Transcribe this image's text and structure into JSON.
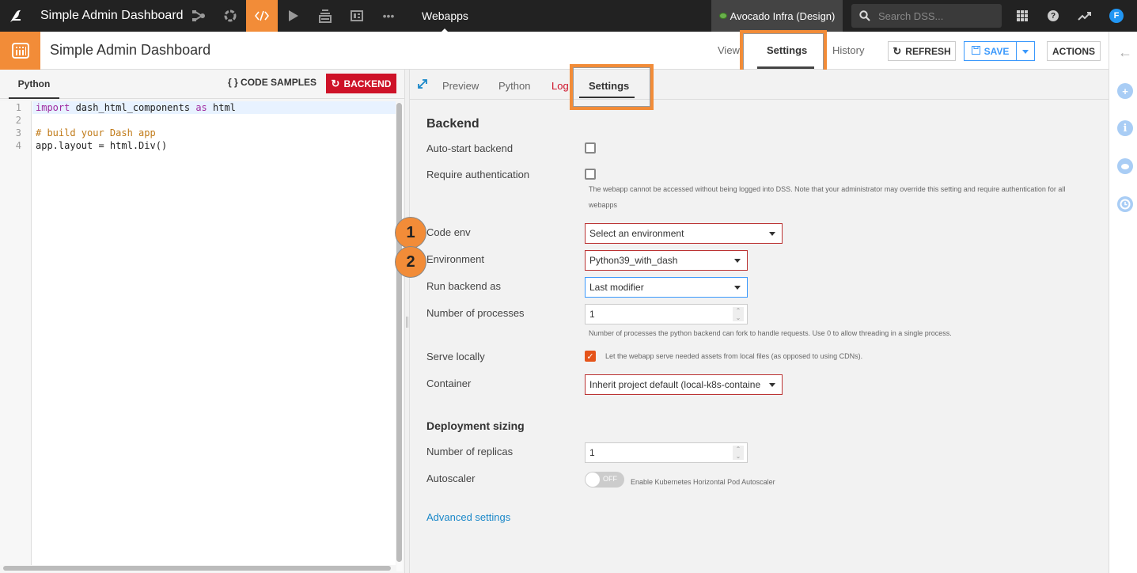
{
  "topbar": {
    "project_title": "Simple Admin Dashboard",
    "nav_icons": [
      "flow-icon",
      "recipes-icon",
      "code-icon",
      "run-icon",
      "datasets-icon",
      "dashboard-icon",
      "more-icon"
    ],
    "section": "Webapps",
    "instance_name": "Avocado Infra (Design)",
    "search_placeholder": "Search DSS...",
    "avatar_initial": "F"
  },
  "header": {
    "object_title": "Simple Admin Dashboard",
    "tabs": [
      {
        "label": "View",
        "active": false
      },
      {
        "label": "Settings",
        "active": true
      },
      {
        "label": "History",
        "active": false
      }
    ],
    "refresh_label": "REFRESH",
    "save_label": "SAVE",
    "actions_label": "ACTIONS"
  },
  "editor": {
    "tab_label": "Python",
    "code_samples_label": "CODE SAMPLES",
    "backend_label": "BACKEND",
    "line_numbers": [
      "1",
      "2",
      "3",
      "4"
    ],
    "lines": [
      {
        "kw": "import",
        "rest": " dash_html_components ",
        "kw2": "as",
        "rest2": " html"
      },
      {
        "text": ""
      },
      {
        "comment": "# build your Dash app"
      },
      {
        "text": "app.layout = html.Div()"
      }
    ]
  },
  "settings": {
    "tabs": [
      {
        "label": "Preview"
      },
      {
        "label": "Python"
      },
      {
        "label": "Log"
      },
      {
        "label": "Settings",
        "active": true
      }
    ],
    "backend_title": "Backend",
    "auto_start_label": "Auto-start backend",
    "auto_start_checked": false,
    "require_auth_label": "Require authentication",
    "require_auth_checked": false,
    "require_auth_help_1": "The webapp cannot be accessed without being logged into DSS. Note that your administrator may override this setting and require authentication for all",
    "require_auth_help_2": "webapps",
    "code_env_label": "Code env",
    "code_env_value": "Select an environment",
    "environment_label": "Environment",
    "environment_value": "Python39_with_dash",
    "run_as_label": "Run backend as",
    "run_as_value": "Last modifier",
    "processes_label": "Number of processes",
    "processes_value": "1",
    "processes_help": "Number of processes the python backend can fork to handle requests. Use 0 to allow threading in a single process.",
    "serve_locally_label": "Serve locally",
    "serve_locally_checked": true,
    "serve_locally_help": "Let the webapp serve needed assets from local files (as opposed to using CDNs).",
    "container_label": "Container",
    "container_value": "Inherit project default (local-k8s-containe",
    "deployment_title": "Deployment sizing",
    "replicas_label": "Number of replicas",
    "replicas_value": "1",
    "autoscaler_label": "Autoscaler",
    "autoscaler_state": "OFF",
    "autoscaler_help": "Enable Kubernetes Horizontal Pod Autoscaler",
    "advanced_link": "Advanced settings"
  },
  "annotations": {
    "badge_1": "1",
    "badge_2": "2"
  },
  "colors": {
    "accent": "#f28c38",
    "danger": "#ce1228",
    "primary": "#3b99fc",
    "link": "#1a88c9"
  }
}
